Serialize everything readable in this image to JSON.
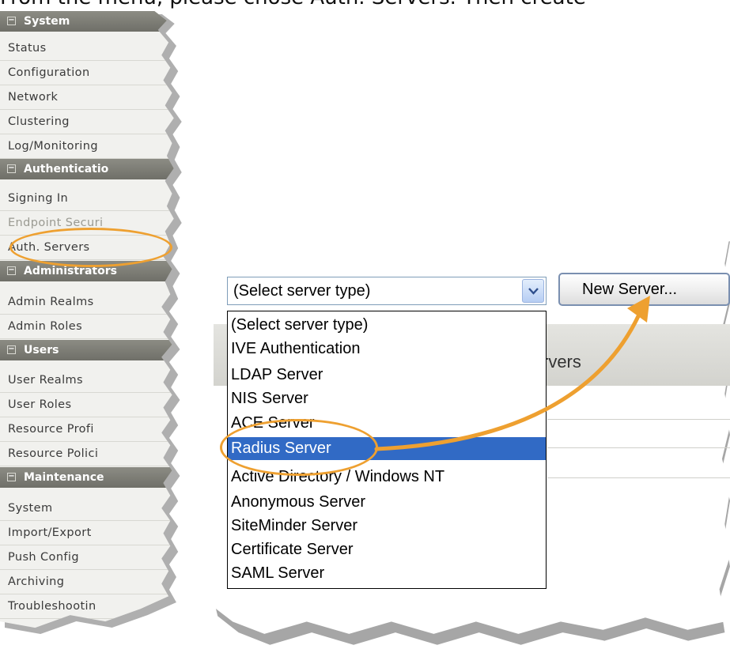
{
  "instruction": "From the menu, please chose Auth. Servers. Then create",
  "nav": {
    "sections": [
      {
        "header": "System",
        "items": [
          "Status",
          "Configuration",
          "Network",
          "Clustering",
          "Log/Monitoring"
        ]
      },
      {
        "header": "Authenticatio",
        "items": [
          "Signing In",
          "Endpoint Securi",
          "Auth. Servers"
        ]
      },
      {
        "header": "Administrators",
        "items": [
          "Admin Realms",
          "Admin Roles"
        ]
      },
      {
        "header": "Users",
        "items": [
          "User Realms",
          "User Roles",
          "Resource Profi",
          "Resource Polici"
        ]
      },
      {
        "header": "Maintenance",
        "items": [
          "System",
          "Import/Export",
          "Push Config",
          "Archiving",
          "Troubleshootin"
        ]
      }
    ]
  },
  "server_type_select": {
    "value": "(Select server type)",
    "options": [
      "(Select server type)",
      "IVE Authentication",
      "LDAP Server",
      "NIS Server",
      "ACE Server",
      "Radius Server",
      "Active Directory / Windows NT",
      "Anonymous Server",
      "SiteMinder Server",
      "Certificate Server",
      "SAML Server"
    ],
    "highlighted": "Radius Server"
  },
  "new_server_button": "New Server...",
  "table_header_fragment": "rvers",
  "colors": {
    "nav_header_bg": "#7c7c75",
    "nav_bg": "#f1f1ee",
    "highlight_orange": "#eea030",
    "selection_blue": "#316ac5"
  }
}
